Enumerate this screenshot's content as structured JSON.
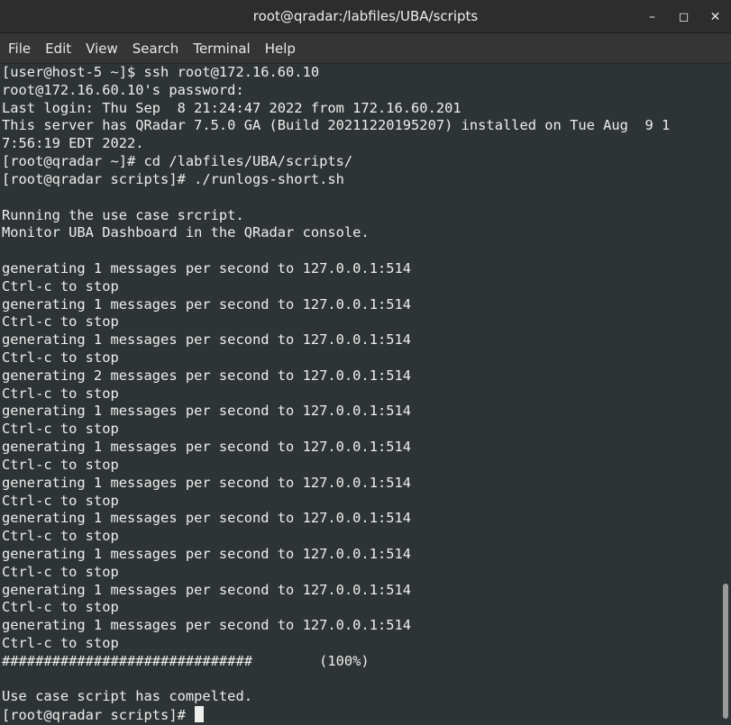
{
  "window": {
    "title": "root@qradar:/labfiles/UBA/scripts",
    "controls": {
      "minimize_glyph": "–",
      "maximize_glyph": "◻",
      "close_glyph": "✕"
    }
  },
  "menubar": {
    "items": [
      "File",
      "Edit",
      "View",
      "Search",
      "Terminal",
      "Help"
    ]
  },
  "terminal": {
    "lines": [
      "[user@host-5 ~]$ ssh root@172.16.60.10",
      "root@172.16.60.10's password:",
      "Last login: Thu Sep  8 21:24:47 2022 from 172.16.60.201",
      "This server has QRadar 7.5.0 GA (Build 20211220195207) installed on Tue Aug  9 1",
      "7:56:19 EDT 2022.",
      "[root@qradar ~]# cd /labfiles/UBA/scripts/",
      "[root@qradar scripts]# ./runlogs-short.sh",
      "",
      "Running the use case srcript.",
      "Monitor UBA Dashboard in the QRadar console.",
      "",
      "generating 1 messages per second to 127.0.0.1:514",
      "Ctrl-c to stop",
      "generating 1 messages per second to 127.0.0.1:514",
      "Ctrl-c to stop",
      "generating 1 messages per second to 127.0.0.1:514",
      "Ctrl-c to stop",
      "generating 2 messages per second to 127.0.0.1:514",
      "Ctrl-c to stop",
      "generating 1 messages per second to 127.0.0.1:514",
      "Ctrl-c to stop",
      "generating 1 messages per second to 127.0.0.1:514",
      "Ctrl-c to stop",
      "generating 1 messages per second to 127.0.0.1:514",
      "Ctrl-c to stop",
      "generating 1 messages per second to 127.0.0.1:514",
      "Ctrl-c to stop",
      "generating 1 messages per second to 127.0.0.1:514",
      "Ctrl-c to stop",
      "generating 1 messages per second to 127.0.0.1:514",
      "Ctrl-c to stop",
      "generating 1 messages per second to 127.0.0.1:514",
      "Ctrl-c to stop",
      "##############################        (100%)",
      "",
      "Use case script has compelted."
    ],
    "prompt": "[root@qradar scripts]# "
  },
  "colors": {
    "terminal_bg": "#2e3436",
    "terminal_fg": "#eeeeec",
    "titlebar_bg": "#2d2d2d",
    "menubar_bg": "#353535"
  }
}
